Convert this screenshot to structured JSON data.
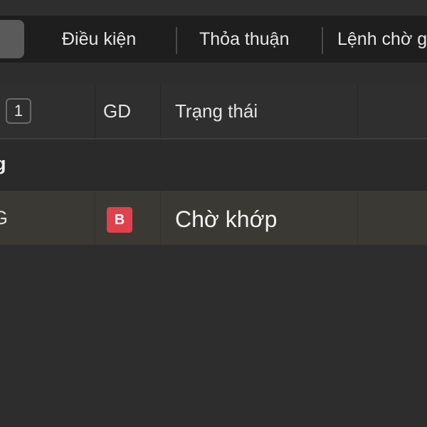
{
  "tabs": [
    {
      "label": "",
      "active": true
    },
    {
      "label": "Điều kiện",
      "active": false
    },
    {
      "label": "Thỏa thuận",
      "active": false
    },
    {
      "label": "Lệnh chờ g",
      "active": false
    }
  ],
  "table": {
    "header": {
      "count_badge": "1",
      "columns": [
        "GD",
        "Trạng thái"
      ]
    },
    "group": {
      "label": "g"
    },
    "rows": [
      {
        "first_cell_fragment": "G",
        "side": "B",
        "status": "Chờ khớp"
      }
    ]
  },
  "colors": {
    "background": "#2d2d2d",
    "tabbar": "#1e1e1e",
    "buy_badge": "#e0414d",
    "selected_row": "#3a3934"
  }
}
